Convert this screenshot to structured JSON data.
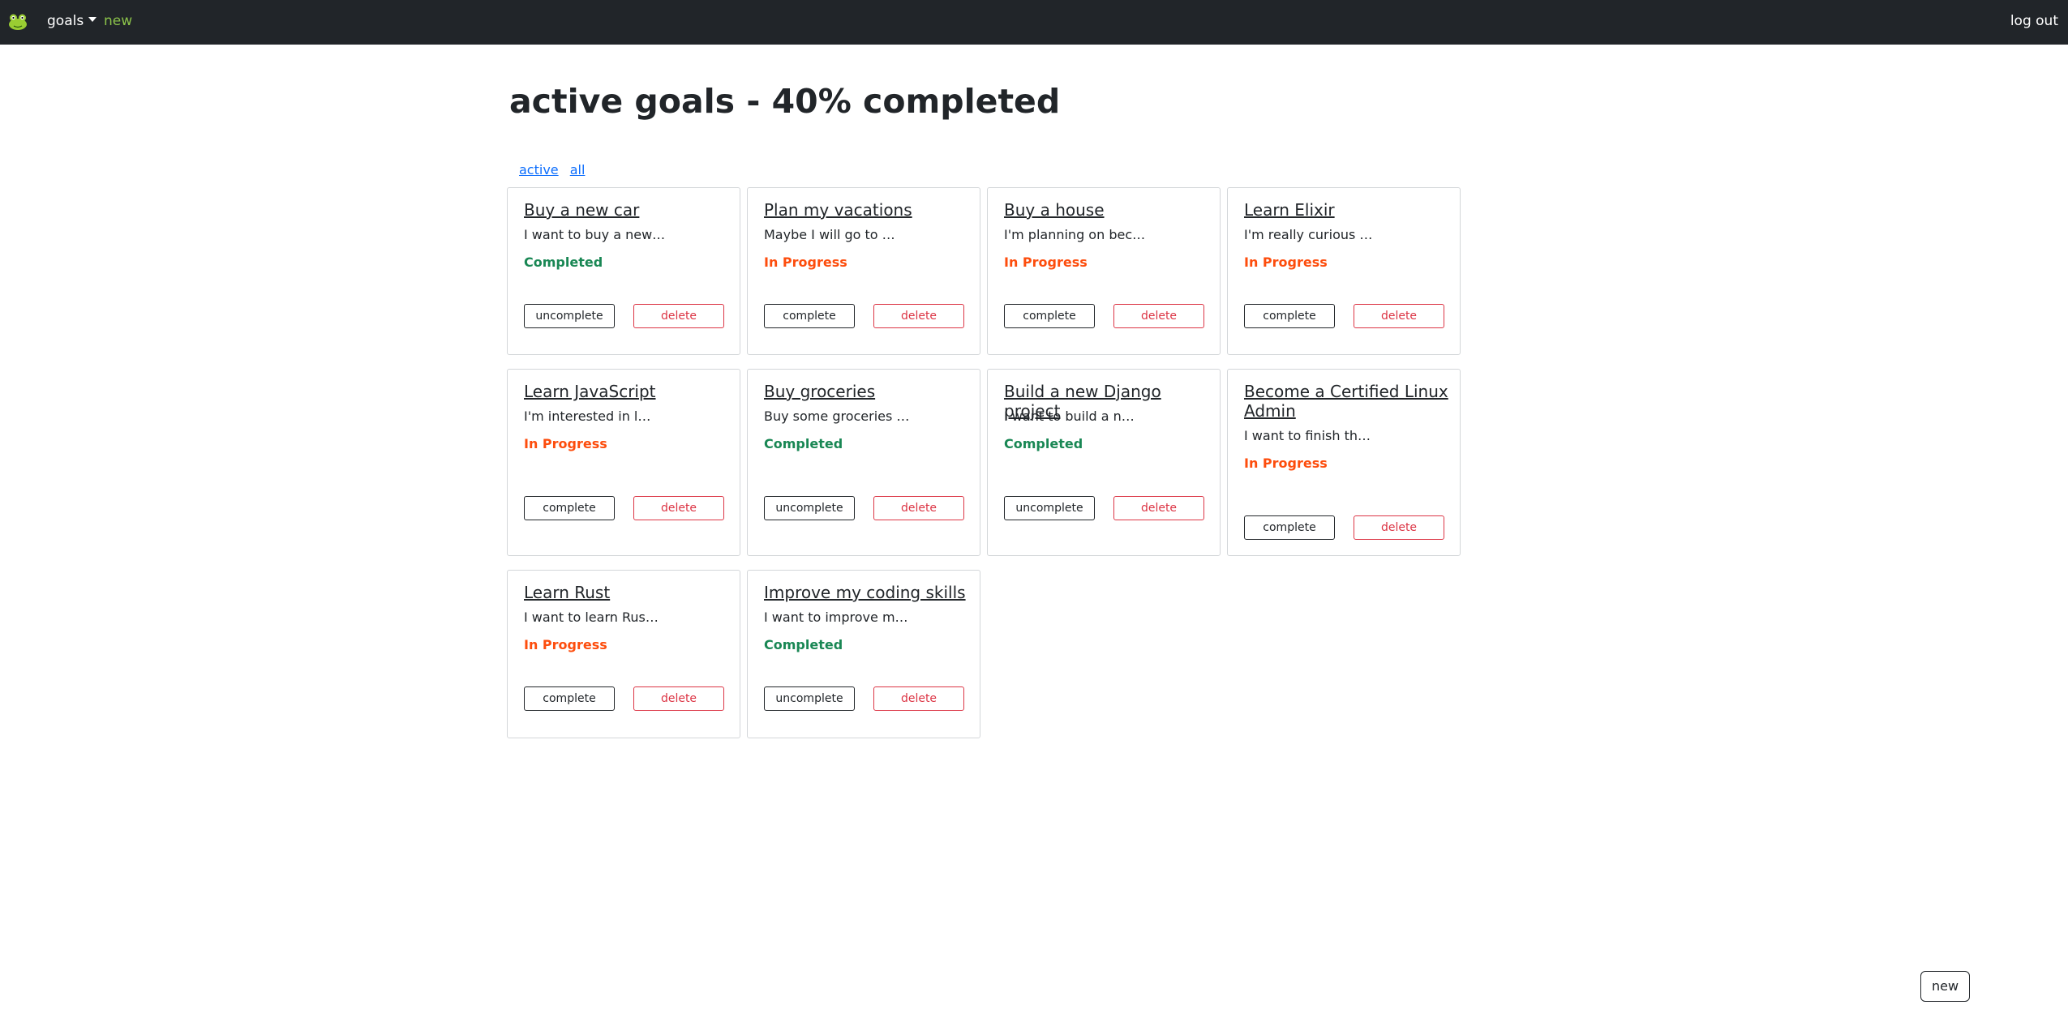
{
  "nav": {
    "logo_icon": "frog-icon",
    "goals_label": "goals",
    "new_label": "new",
    "logout_label": "log out"
  },
  "page": {
    "title": "active goals - 40% completed"
  },
  "filters": {
    "active_label": "active",
    "all_label": "all"
  },
  "goals": [
    {
      "title": "Buy a new car",
      "description": "I want to buy a new…",
      "status": "Completed",
      "toggle_label": "uncomplete",
      "delete_label": "delete"
    },
    {
      "title": "Plan my vacations",
      "description": "Maybe I will go to …",
      "status": "In Progress",
      "toggle_label": "complete",
      "delete_label": "delete"
    },
    {
      "title": "Buy a house",
      "description": "I'm planning on bec…",
      "status": "In Progress",
      "toggle_label": "complete",
      "delete_label": "delete"
    },
    {
      "title": "Learn Elixir",
      "description": "I'm really curious …",
      "status": "In Progress",
      "toggle_label": "complete",
      "delete_label": "delete"
    },
    {
      "title": "Learn JavaScript",
      "description": "I'm interested in l…",
      "status": "In Progress",
      "toggle_label": "complete",
      "delete_label": "delete"
    },
    {
      "title": "Buy groceries",
      "description": "Buy some groceries …",
      "status": "Completed",
      "toggle_label": "uncomplete",
      "delete_label": "delete"
    },
    {
      "title": "Build a new Django project",
      "description": "I want to build a n…",
      "status": "Completed",
      "toggle_label": "uncomplete",
      "delete_label": "delete"
    },
    {
      "title": "Become a Certified Linux Admin",
      "description": "I want to finish th…",
      "status": "In Progress",
      "toggle_label": "complete",
      "delete_label": "delete"
    },
    {
      "title": "Learn Rust",
      "description": "I want to learn Rus…",
      "status": "In Progress",
      "toggle_label": "complete",
      "delete_label": "delete"
    },
    {
      "title": "Improve my coding skills",
      "description": "I want to improve m…",
      "status": "Completed",
      "toggle_label": "uncomplete",
      "delete_label": "delete"
    }
  ],
  "footer": {
    "new_button_label": "new"
  },
  "colors": {
    "navbar_bg": "#212529",
    "new_link": "#8bc34a",
    "completed": "#198754",
    "in_progress": "#fd4d0d",
    "delete": "#dc3545",
    "link": "#0d6efd"
  }
}
